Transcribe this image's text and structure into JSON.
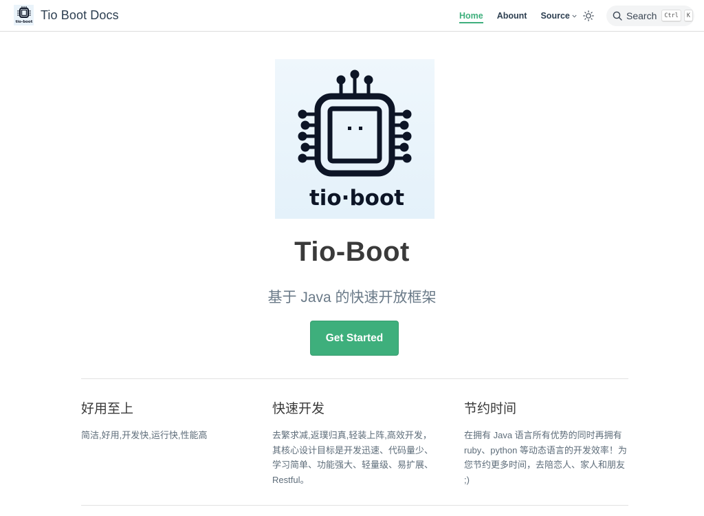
{
  "navbar": {
    "brand_title": "Tio Boot Docs",
    "logo_caption": "tio-boot",
    "links": [
      {
        "label": "Home",
        "active": true
      },
      {
        "label": "Abount",
        "active": false
      },
      {
        "label": "Source",
        "active": false,
        "has_dropdown": true
      }
    ],
    "theme_toggle_icon": "sun-icon",
    "search": {
      "label": "Search",
      "keys": [
        "Ctrl",
        "K"
      ]
    }
  },
  "hero": {
    "image_caption": "tio·boot",
    "title": "Tio-Boot",
    "subtitle": "基于 Java 的快速开放框架",
    "action_label": "Get Started",
    "accent_color": "#3eaf7c"
  },
  "features": [
    {
      "title": "好用至上",
      "details": "简洁,好用,开发快,运行快,性能高"
    },
    {
      "title": "快速开发",
      "details": "去繁求减,返璞归真,轻装上阵,高效开发，其核心设计目标是开发迅速、代码量少、学习简单、功能强大、轻量级、易扩展、Restful。"
    },
    {
      "title": "节约时间",
      "details": "在拥有 Java 语言所有优势的同时再拥有 ruby、python 等动态语言的开发效率！为您节约更多时间，去陪恋人、家人和朋友 ;)"
    }
  ]
}
